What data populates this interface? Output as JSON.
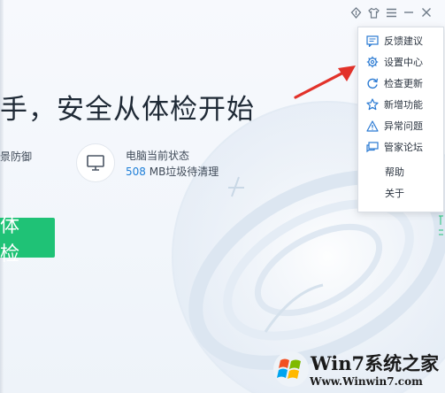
{
  "main": {
    "headline": "手，安全从体检开始",
    "left_status": "景防御",
    "pc_status_title": "电脑当前状态",
    "pc_status_number": "508",
    "pc_status_suffix": " MB垃圾待清理",
    "check_button": "体检"
  },
  "titlebar": {
    "icons": [
      "skin-icon",
      "shirt-icon",
      "menu-icon",
      "minimize-icon",
      "close-icon"
    ]
  },
  "menu": {
    "items": [
      {
        "label": "反馈建议",
        "icon": "feedback-icon"
      },
      {
        "label": "设置中心",
        "icon": "gear-icon"
      },
      {
        "label": "检查更新",
        "icon": "refresh-icon"
      },
      {
        "label": "新增功能",
        "icon": "star-icon"
      },
      {
        "label": "异常问题",
        "icon": "warning-icon"
      },
      {
        "label": "管家论坛",
        "icon": "forum-icon"
      },
      {
        "label": "帮助"
      },
      {
        "label": "关于"
      }
    ]
  },
  "watermark": {
    "brand": "Win7系统之家",
    "url": "Www.Winwin7.com"
  },
  "colors": {
    "accent_green": "#1fc276",
    "link_blue": "#1e7fd8",
    "arrow_red": "#e2322a"
  }
}
